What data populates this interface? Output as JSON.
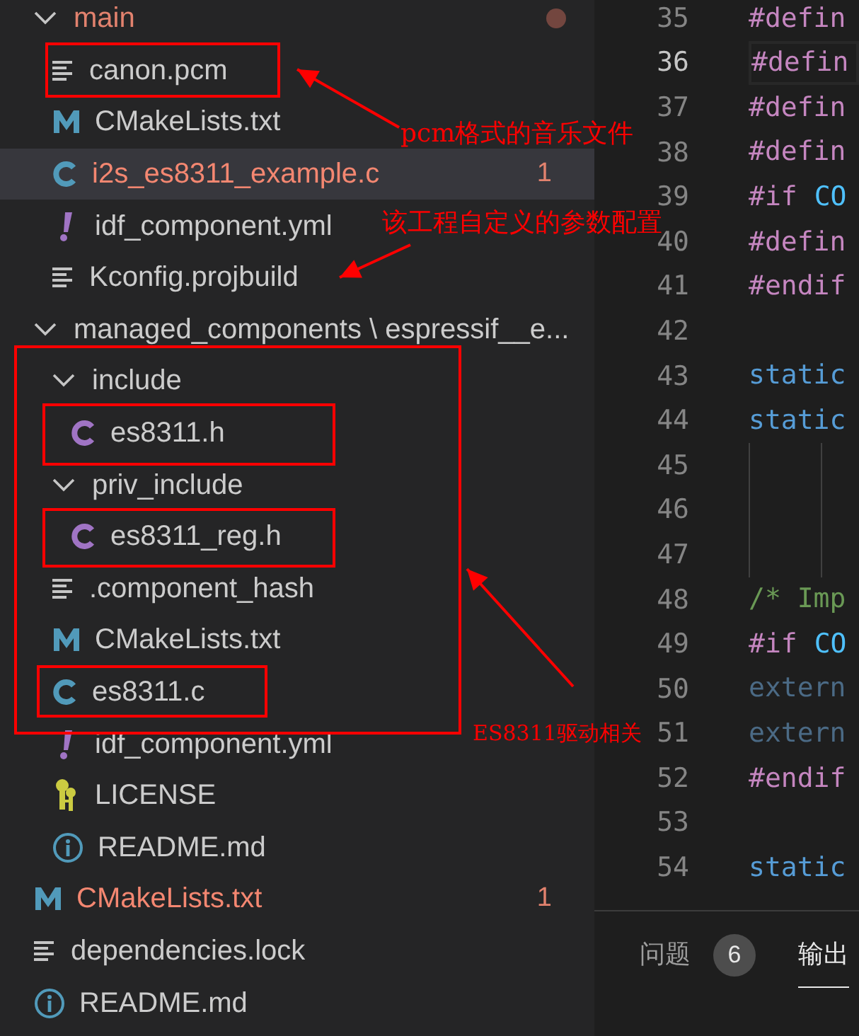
{
  "explorer": {
    "tree": [
      {
        "kind": "folder",
        "label": "main",
        "expanded": true,
        "has_changes": true,
        "children": [
          {
            "kind": "text-file",
            "label": "canon.pcm",
            "selected": false,
            "error": false
          },
          {
            "kind": "cmake-file",
            "label": "CMakeLists.txt",
            "selected": false,
            "error": false
          },
          {
            "kind": "c-file",
            "label": "i2s_es8311_example.c",
            "selected": true,
            "error": true,
            "badge": "1"
          },
          {
            "kind": "yaml-file",
            "label": "idf_component.yml",
            "selected": false,
            "error": false
          },
          {
            "kind": "text-file",
            "label": "Kconfig.projbuild",
            "selected": false,
            "error": false
          }
        ]
      },
      {
        "kind": "folder",
        "label": "managed_components \\ espressif__e...",
        "expanded": true,
        "has_changes": false,
        "children": [
          {
            "kind": "folder",
            "label": "include",
            "expanded": true,
            "has_changes": false,
            "children": [
              {
                "kind": "header-file",
                "label": "es8311.h",
                "selected": false,
                "error": false
              }
            ]
          },
          {
            "kind": "folder",
            "label": "priv_include",
            "expanded": true,
            "has_changes": false,
            "children": [
              {
                "kind": "header-file",
                "label": "es8311_reg.h",
                "selected": false,
                "error": false
              }
            ]
          },
          {
            "kind": "text-file",
            "label": ".component_hash",
            "selected": false,
            "error": false
          },
          {
            "kind": "cmake-file",
            "label": "CMakeLists.txt",
            "selected": false,
            "error": false
          },
          {
            "kind": "c-file",
            "label": "es8311.c",
            "selected": false,
            "error": false
          },
          {
            "kind": "yaml-file",
            "label": "idf_component.yml",
            "selected": false,
            "error": false
          },
          {
            "kind": "license-file",
            "label": "LICENSE",
            "selected": false,
            "error": false
          },
          {
            "kind": "readme-file",
            "label": "README.md",
            "selected": false,
            "error": false
          }
        ]
      },
      {
        "kind": "cmake-file",
        "label": "CMakeLists.txt",
        "selected": false,
        "error": true,
        "badge": "1"
      },
      {
        "kind": "text-file",
        "label": "dependencies.lock",
        "selected": false,
        "error": false
      },
      {
        "kind": "readme-file",
        "label": "README.md",
        "selected": false,
        "error": false
      }
    ]
  },
  "editor": {
    "lines": [
      {
        "number": "35",
        "current": false,
        "tokens": [
          {
            "kind": "preproc",
            "text": "#defin"
          }
        ]
      },
      {
        "number": "36",
        "current": true,
        "tokens": [
          {
            "kind": "preproc",
            "text": "#defin"
          }
        ]
      },
      {
        "number": "37",
        "current": false,
        "tokens": [
          {
            "kind": "preproc",
            "text": "#defin"
          }
        ]
      },
      {
        "number": "38",
        "current": false,
        "tokens": [
          {
            "kind": "preproc",
            "text": "#defin"
          }
        ]
      },
      {
        "number": "39",
        "current": false,
        "tokens": [
          {
            "kind": "preproc",
            "text": "#if"
          },
          {
            "kind": "macro",
            "text": "CO"
          }
        ]
      },
      {
        "number": "40",
        "current": false,
        "tokens": [
          {
            "kind": "preproc",
            "text": "#defin"
          }
        ]
      },
      {
        "number": "41",
        "current": false,
        "tokens": [
          {
            "kind": "preproc",
            "text": "#endif"
          }
        ]
      },
      {
        "number": "42",
        "current": false
      },
      {
        "number": "43",
        "current": false,
        "tokens": [
          {
            "kind": "keyword",
            "text": "static"
          }
        ]
      },
      {
        "number": "44",
        "current": false,
        "tokens": [
          {
            "kind": "keyword",
            "text": "static"
          }
        ]
      },
      {
        "number": "45",
        "current": false,
        "guides": true
      },
      {
        "number": "46",
        "current": false,
        "guides": true
      },
      {
        "number": "47",
        "current": false,
        "guides": true
      },
      {
        "number": "48",
        "current": false,
        "tokens": [
          {
            "kind": "comment",
            "text": "/* Imp"
          }
        ]
      },
      {
        "number": "49",
        "current": false,
        "tokens": [
          {
            "kind": "preproc",
            "text": "#if"
          },
          {
            "kind": "macro",
            "text": "CO"
          }
        ]
      },
      {
        "number": "50",
        "current": false,
        "tokens": [
          {
            "kind": "inactive",
            "text": "extern"
          }
        ]
      },
      {
        "number": "51",
        "current": false,
        "tokens": [
          {
            "kind": "inactive",
            "text": "extern"
          }
        ]
      },
      {
        "number": "52",
        "current": false,
        "tokens": [
          {
            "kind": "preproc",
            "text": "#endif"
          }
        ]
      },
      {
        "number": "53",
        "current": false
      },
      {
        "number": "54",
        "current": false,
        "tokens": [
          {
            "kind": "keyword",
            "text": "static"
          }
        ]
      }
    ]
  },
  "panel": {
    "tabs": [
      {
        "label": "问题",
        "badge": "6",
        "selected": false
      },
      {
        "label": "输出",
        "selected": true
      }
    ]
  },
  "annotations": [
    "pcm格式的音乐文件",
    "该工程自定义的参数配置",
    "ES8311驱动相关"
  ]
}
